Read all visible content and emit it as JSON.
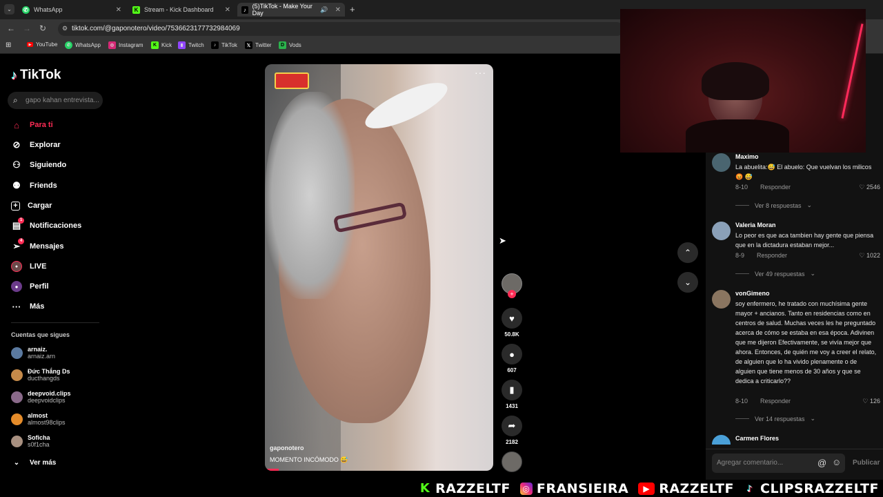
{
  "browser": {
    "tabs": [
      {
        "title": "WhatsApp"
      },
      {
        "title": "Stream - Kick Dashboard"
      },
      {
        "title": "(5)TikTok - Make Your Day"
      }
    ],
    "url": "tiktok.com/@gaponotero/video/7536623177732984069",
    "bookmarks": [
      "YouTube",
      "WhatsApp",
      "Instagram",
      "Kick",
      "Twitch",
      "TikTok",
      "Twitter",
      "Vods"
    ]
  },
  "sidebar": {
    "logo": "TikTok",
    "search_placeholder": "gapo kahan entrevista...",
    "nav": [
      {
        "label": "Para ti"
      },
      {
        "label": "Explorar"
      },
      {
        "label": "Siguiendo"
      },
      {
        "label": "Friends"
      },
      {
        "label": "Cargar"
      },
      {
        "label": "Notificaciones",
        "badge": "1"
      },
      {
        "label": "Mensajes",
        "badge": "4"
      },
      {
        "label": "LIVE"
      },
      {
        "label": "Perfil"
      },
      {
        "label": "Más"
      }
    ],
    "following_title": "Cuentas que sigues",
    "accounts": [
      {
        "name": "arnaiz.",
        "handle": "arnaiz.arn"
      },
      {
        "name": "Đức Thắng Ds",
        "handle": "ducthangds"
      },
      {
        "name": "deepvoid.clips",
        "handle": "deepvoidclips"
      },
      {
        "name": "almost",
        "handle": "almost98clips"
      },
      {
        "name": "Soficha",
        "handle": "s0f1cha"
      }
    ],
    "see_more": "Ver más"
  },
  "video": {
    "author": "gaponotero",
    "caption": "MOMENTO INCÓMODO 😅",
    "stats": {
      "likes": "50.8K",
      "comments": "607",
      "saves": "1431",
      "shares": "2182"
    }
  },
  "comments": [
    {
      "user": "Maximo",
      "text": "La abuelita:😅 El abuelo: Que vuelvan los milicos😡 😅",
      "date": "8-10",
      "reply": "Responder",
      "likes": "2546",
      "more": "Ver 8 respuestas"
    },
    {
      "user": "Valeria Moran",
      "text": "Lo peor es que aca tambien hay gente que piensa que en la dictadura estaban mejor...",
      "date": "8-9",
      "reply": "Responder",
      "likes": "1022",
      "more": "Ver 49 respuestas"
    },
    {
      "user": "vonGimeno",
      "text": "soy enfermero, he tratado con muchísima gente mayor + ancianos. Tanto en residencias como en centros de salud. Muchas veces les he preguntado acerca de cómo se estaba en esa época. Adivinen que me dijeron Efectivamente, se vivía mejor que ahora. Entonces, de quién me voy a creer el relato, de alguien que lo ha vivido plenamente o de alguien que tiene menos de 30 años y que se dedica a criticarlo??",
      "date": "8-10",
      "reply": "Responder",
      "likes": "126",
      "more": "Ver 14 respuestas"
    },
    {
      "user": "Carmen Flores"
    }
  ],
  "comment_input": {
    "placeholder": "Agregar comentario...",
    "publish": "Publicar"
  },
  "stream_overlay": [
    "RAZZELTF",
    "FRANSIEIRA",
    "RAZZELTF",
    "CLIPSRAZZELTF"
  ],
  "colors": {
    "accent": "#fe2c55",
    "kick": "#53fc18"
  }
}
